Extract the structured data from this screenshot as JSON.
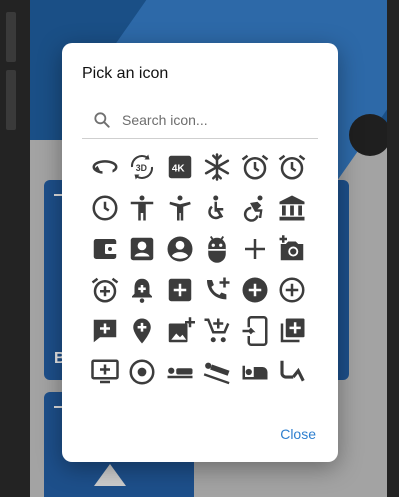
{
  "dialog": {
    "title": "Pick an icon",
    "search": {
      "placeholder": "Search icon...",
      "value": ""
    },
    "close_label": "Close",
    "accent_color": "#2e7fcf"
  },
  "background": {
    "card_letter": "B"
  },
  "icons": [
    "rotate-left-icon",
    "3d-rotation-icon",
    "4k-icon",
    "ac-unit-icon",
    "access-alarm-icon",
    "access-alarms-icon",
    "access-time-icon",
    "accessibility-icon",
    "accessibility-new-icon",
    "accessible-icon",
    "accessible-forward-icon",
    "account-balance-icon",
    "account-balance-wallet-icon",
    "account-box-icon",
    "account-circle-icon",
    "adb-icon",
    "add-icon",
    "add-a-photo-icon",
    "add-alarm-icon",
    "add-alert-icon",
    "add-box-icon",
    "add-call-icon",
    "add-circle-icon",
    "add-circle-outline-icon",
    "add-comment-icon",
    "add-location-icon",
    "add-photo-alternate-icon",
    "add-shopping-cart-icon",
    "add-to-home-screen-icon",
    "add-to-photos-icon",
    "add-to-queue-icon",
    "adjust-icon",
    "airline-seat-flat-icon",
    "airline-seat-flat-angled-icon",
    "airline-seat-individual-suite-icon",
    "airline-seat-legroom-extra-icon"
  ]
}
